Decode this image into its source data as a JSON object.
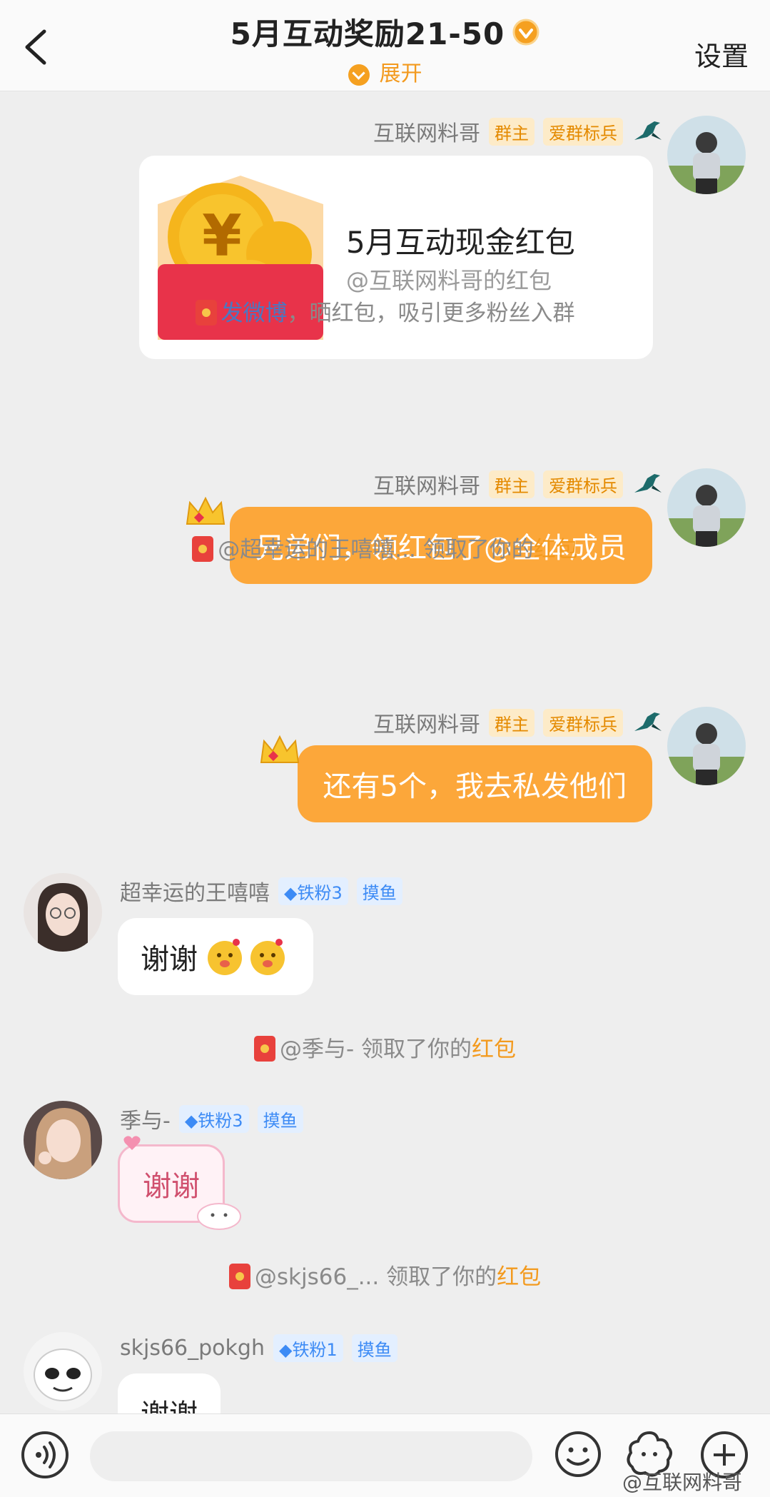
{
  "header": {
    "title": "5月互动奖励21-50",
    "expand_label": "展开",
    "settings_label": "设置"
  },
  "messages": {
    "m1": {
      "sender": "互联网料哥",
      "tag_owner": "群主",
      "tag_soldier": "爱群标兵",
      "card_title": "5月互动现金红包",
      "card_sub": "@互联网料哥的红包"
    },
    "sys1": {
      "link": "发微博",
      "rest": "，晒红包，吸引更多粉丝入群"
    },
    "m2": {
      "sender": "互联网料哥",
      "tag_owner": "群主",
      "tag_soldier": "爱群标兵",
      "text": "兄弟们，领红包了@全体成员"
    },
    "sys2": {
      "prefix": "@超幸运的王嘻嘻... 领取了你的",
      "hl": "红包"
    },
    "m3": {
      "sender": "互联网料哥",
      "tag_owner": "群主",
      "tag_soldier": "爱群标兵",
      "text": "还有5个，我去私发他们"
    },
    "m4": {
      "sender": "超幸运的王嘻嘻",
      "tag_fan": "铁粉3",
      "tag_fish": "摸鱼",
      "text": "谢谢"
    },
    "sys3": {
      "prefix": "@季与- 领取了你的",
      "hl": "红包"
    },
    "m5": {
      "sender": "季与-",
      "tag_fan": "铁粉3",
      "tag_fish": "摸鱼",
      "text": "谢谢"
    },
    "sys4": {
      "prefix": "@skjs66_... 领取了你的",
      "hl": "红包"
    },
    "m6": {
      "sender": "skjs66_pokgh",
      "tag_fan": "铁粉1",
      "tag_fish": "摸鱼",
      "text": "谢谢"
    }
  },
  "watermark": "@互联网料哥",
  "colors": {
    "accent": "#fca73a",
    "link": "#4a78c2",
    "highlight": "#f39a1e"
  }
}
